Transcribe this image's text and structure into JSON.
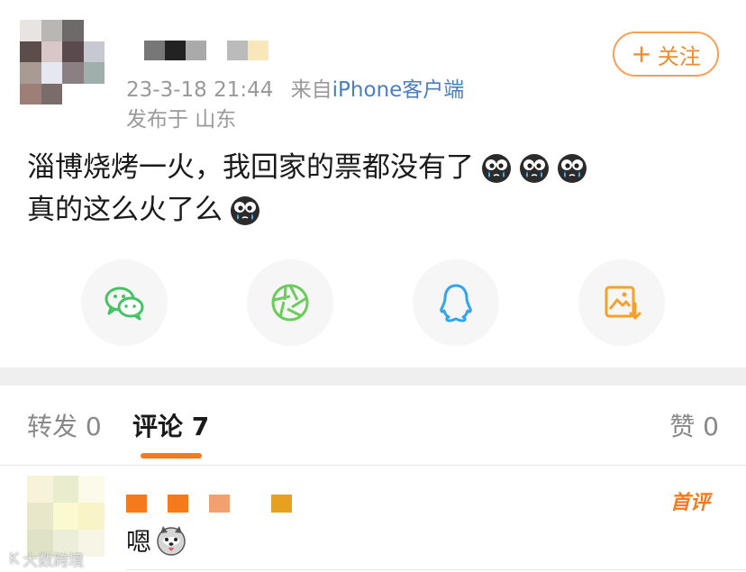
{
  "header": {
    "timestamp": "23-3-18 21:44",
    "from_prefix": "来自",
    "source": "iPhone客户端",
    "location": "发布于 山东",
    "follow_label": "关注",
    "avatar_colors": [
      "#e8e4e2",
      "#b9b6b4",
      "#6e6a6a",
      "#ffffff",
      "#5b4e4a",
      "#d9c6c6",
      "#5a4a4d",
      "#c7c9d2",
      "#a99a94",
      "#e6e7f0",
      "#8a7f83",
      "#9fb0ac",
      "#9e7f78",
      "#7a6c6b",
      "#ffffff",
      "#ffffff"
    ],
    "name_block_colors": [
      "#777777",
      "#222222",
      "#aaaaaa",
      "#ffffff",
      "#bbbbbb",
      "#f8e7b8"
    ]
  },
  "post": {
    "line1": "淄博烧烤一火，我回家的票都没有了",
    "line2": "真的这么火了么",
    "emoji": "crying-face-emoji"
  },
  "share": [
    {
      "name": "wechat-icon",
      "color": "#43c364"
    },
    {
      "name": "moments-icon",
      "color": "#6acc5a"
    },
    {
      "name": "qq-icon",
      "color": "#32a5e8"
    },
    {
      "name": "save-image-icon",
      "color": "#f3a12a"
    }
  ],
  "tabs": {
    "repost_label": "转发",
    "repost_count": "0",
    "comment_label": "评论",
    "comment_count": "7",
    "like_label": "赞",
    "like_count": "0"
  },
  "comment": {
    "text": "嗯",
    "badge": "首评",
    "avatar_colors": [
      "#f6f3d8",
      "#e9eccd",
      "#fcfbe9",
      "#e9e7c9",
      "#fbf9ce",
      "#f8f4c8",
      "#dfe2c5",
      "#eceed9",
      "#f7f5e6"
    ],
    "name_block_colors": [
      "#f47a1c",
      "#ffffff",
      "#f47a1c",
      "#ffffff",
      "#f3a070",
      "#ffffff",
      "#ffffff",
      "#e8a020"
    ]
  },
  "watermark": {
    "text": "大数跨境",
    "logo": "K"
  }
}
